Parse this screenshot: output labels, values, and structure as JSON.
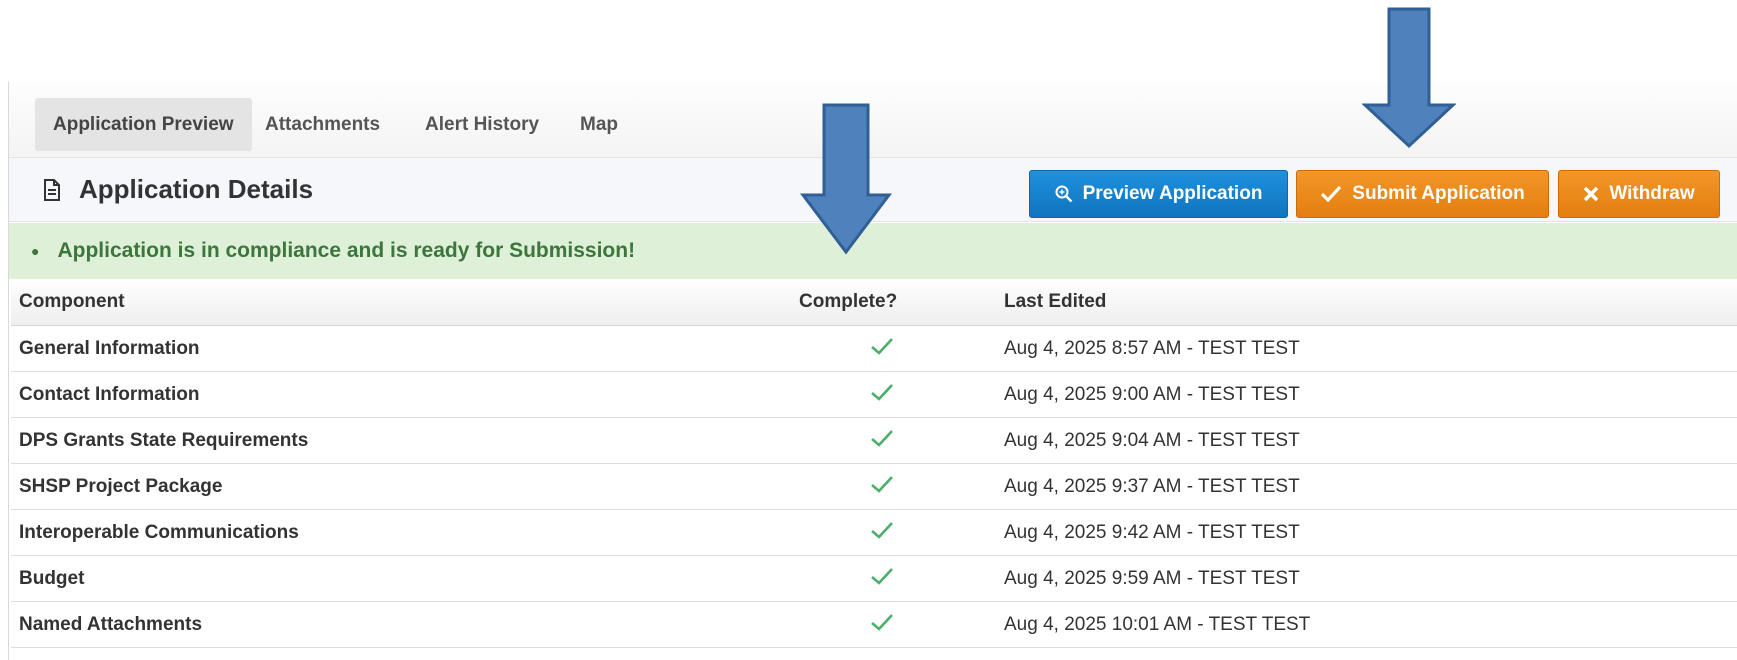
{
  "tabs": [
    {
      "label": "Application Preview",
      "active": true
    },
    {
      "label": "Attachments",
      "active": false
    },
    {
      "label": "Alert History",
      "active": false
    },
    {
      "label": "Map",
      "active": false
    }
  ],
  "header": {
    "title": "Application Details",
    "title_icon": "document-icon",
    "buttons": {
      "preview": {
        "label": "Preview Application",
        "icon": "zoom-icon",
        "color": "#1a85d2"
      },
      "submit": {
        "label": "Submit Application",
        "icon": "checkmark-icon",
        "color": "#ec8b1c"
      },
      "withdraw": {
        "label": "Withdraw",
        "icon": "x-icon",
        "color": "#ec8b1c"
      }
    }
  },
  "alert": {
    "message": "Application is in compliance and is ready for Submission!",
    "color": "#dff0d8"
  },
  "table": {
    "headers": [
      "Component",
      "Complete?",
      "Last Edited"
    ],
    "rows": [
      {
        "component": "General Information",
        "complete": true,
        "last_edited": "Aug 4, 2025 8:57 AM - TEST TEST"
      },
      {
        "component": "Contact Information",
        "complete": true,
        "last_edited": "Aug 4, 2025 9:00 AM - TEST TEST"
      },
      {
        "component": "DPS Grants State Requirements",
        "complete": true,
        "last_edited": "Aug 4, 2025 9:04 AM - TEST TEST"
      },
      {
        "component": "SHSP Project Package",
        "complete": true,
        "last_edited": "Aug 4, 2025 9:37 AM - TEST TEST"
      },
      {
        "component": "Interoperable Communications",
        "complete": true,
        "last_edited": "Aug 4, 2025 9:42 AM - TEST TEST"
      },
      {
        "component": "Budget",
        "complete": true,
        "last_edited": "Aug 4, 2025 9:59 AM - TEST TEST"
      },
      {
        "component": "Named Attachments",
        "complete": true,
        "last_edited": "Aug 4, 2025 10:01 AM - TEST TEST"
      }
    ]
  },
  "annotations": {
    "arrow_color": "#4f81bd",
    "arrow_icon": "down-arrow-icon"
  }
}
